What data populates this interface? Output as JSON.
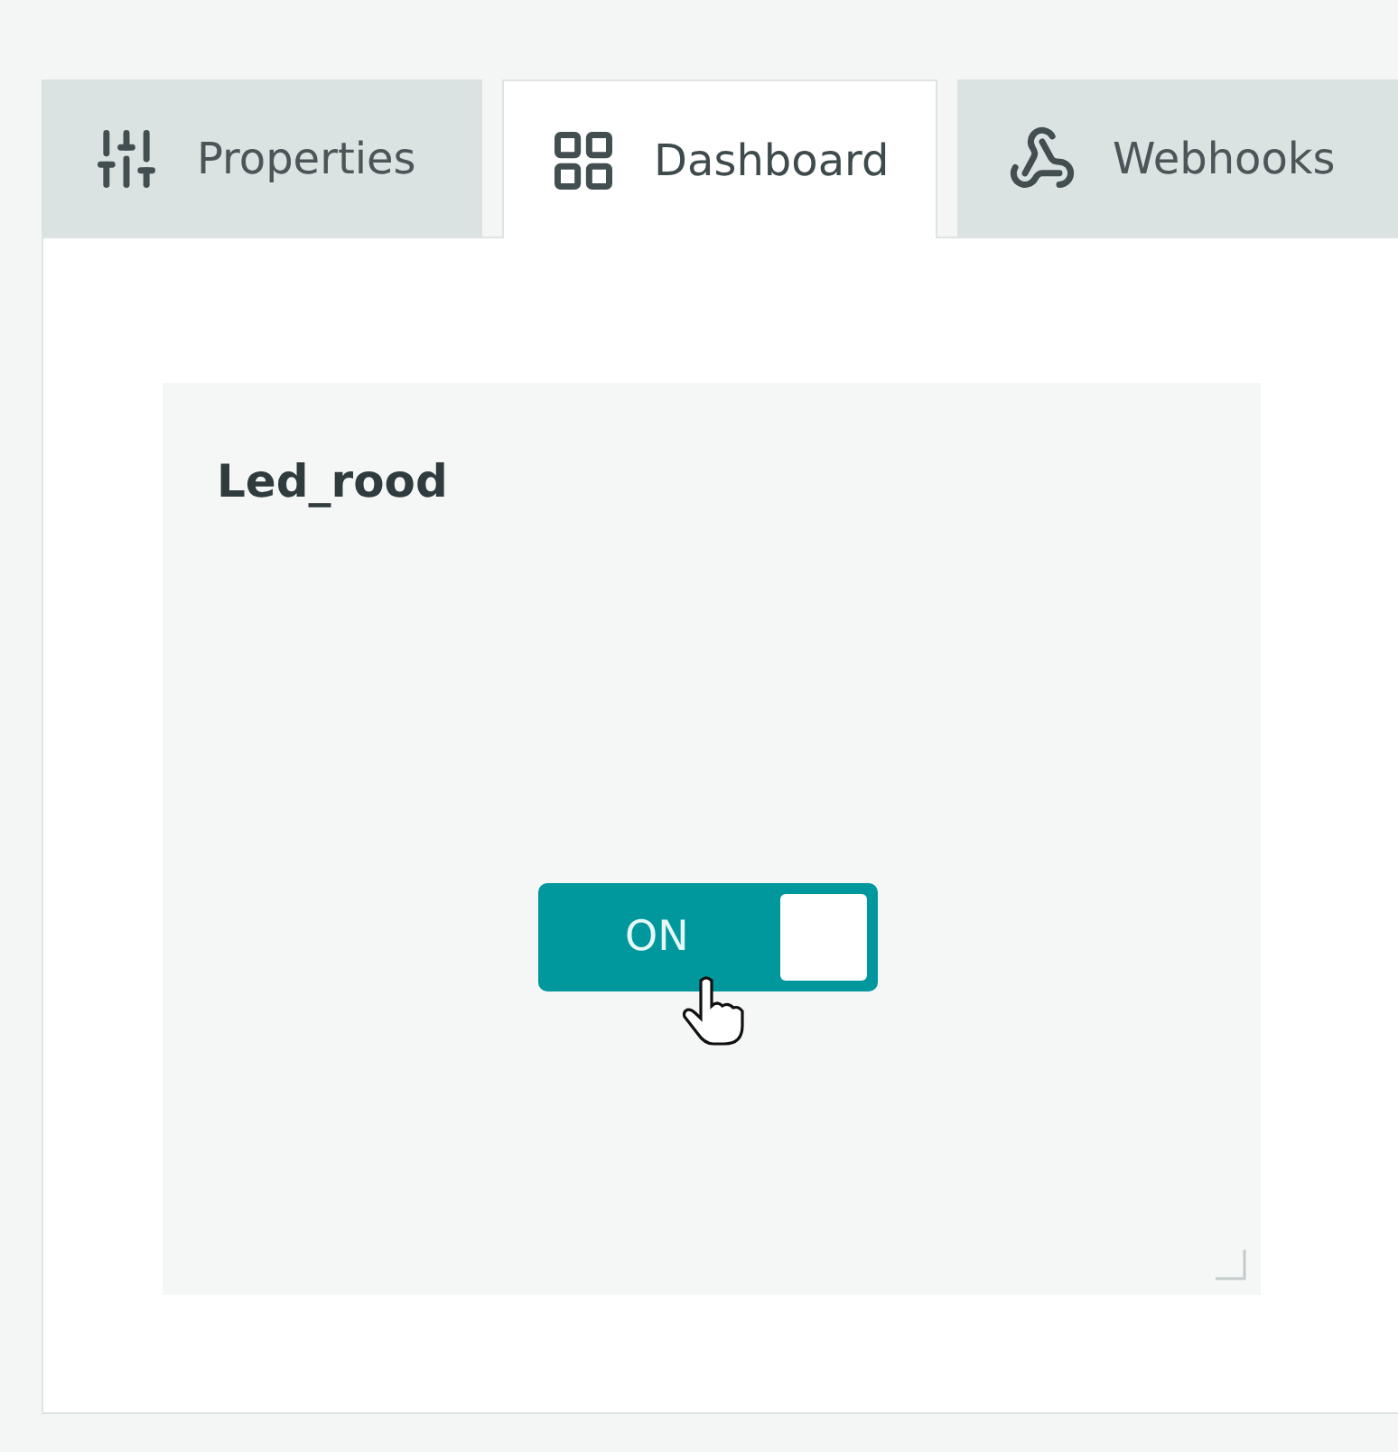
{
  "tabs": [
    {
      "label": "Properties",
      "selected": false
    },
    {
      "label": "Dashboard",
      "selected": true
    },
    {
      "label": "Webhooks",
      "selected": false
    }
  ],
  "widget": {
    "title": "Led_rood",
    "switch": {
      "label": "ON",
      "on": true
    }
  }
}
